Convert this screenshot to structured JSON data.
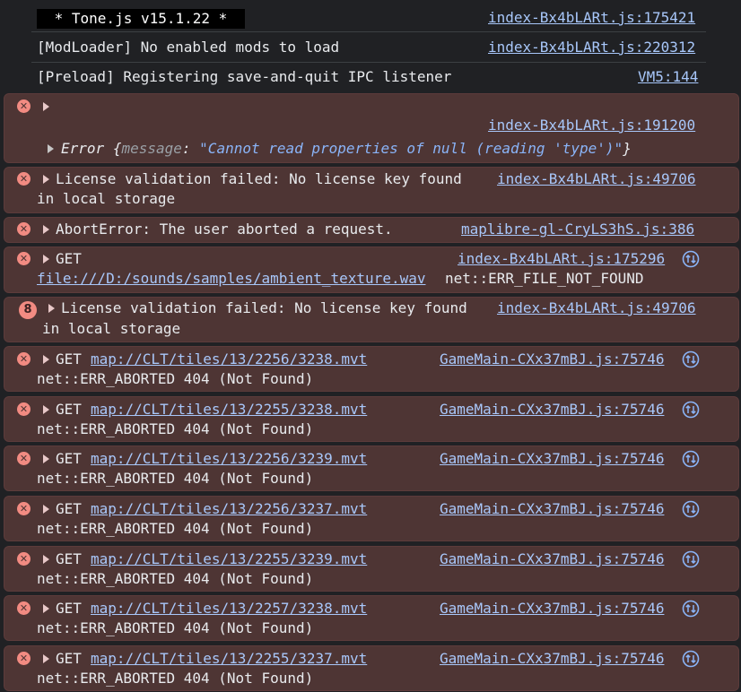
{
  "logs": [
    {
      "text": " * Tone.js v15.1.22 * ",
      "source": "index-Bx4bLARt.js:175421"
    },
    {
      "text": "[ModLoader] No enabled mods to load",
      "source": "index-Bx4bLARt.js:220312"
    },
    {
      "text": "[Preload] Registering save-and-quit IPC listener",
      "source": "VM5:144"
    }
  ],
  "error_null": {
    "source": "index-Bx4bLARt.js:191200",
    "error_label": "Error",
    "open_brace": "{",
    "message_key": "message",
    "colon": ":",
    "message_value": "\"Cannot read properties of null (reading 'type')\"",
    "close_brace": "}"
  },
  "license_error_1": {
    "line1": "License validation failed: No license key found",
    "line2": "in local storage",
    "source": "index-Bx4bLARt.js:49706"
  },
  "abort_error": {
    "text": "AbortError: The user aborted a request.",
    "source": "maplibre-gl-CryLS3hS.js:386"
  },
  "file_error": {
    "method": "GET",
    "url": "file:///D:/sounds/samples/ambient_texture.wav",
    "status": "net::ERR_FILE_NOT_FOUND",
    "source": "index-Bx4bLARt.js:175296"
  },
  "license_error_2": {
    "count": "8",
    "line1": "License validation failed: No license key found",
    "line2": "in local storage",
    "source": "index-Bx4bLARt.js:49706"
  },
  "tile_errors": [
    {
      "method": "GET",
      "url": "map://CLT/tiles/13/2256/3238.mvt",
      "status": "net::ERR_ABORTED 404 (Not Found)",
      "source": "GameMain-CXx37mBJ.js:75746"
    },
    {
      "method": "GET",
      "url": "map://CLT/tiles/13/2255/3238.mvt",
      "status": "net::ERR_ABORTED 404 (Not Found)",
      "source": "GameMain-CXx37mBJ.js:75746"
    },
    {
      "method": "GET",
      "url": "map://CLT/tiles/13/2256/3239.mvt",
      "status": "net::ERR_ABORTED 404 (Not Found)",
      "source": "GameMain-CXx37mBJ.js:75746"
    },
    {
      "method": "GET",
      "url": "map://CLT/tiles/13/2256/3237.mvt",
      "status": "net::ERR_ABORTED 404 (Not Found)",
      "source": "GameMain-CXx37mBJ.js:75746"
    },
    {
      "method": "GET",
      "url": "map://CLT/tiles/13/2255/3239.mvt",
      "status": "net::ERR_ABORTED 404 (Not Found)",
      "source": "GameMain-CXx37mBJ.js:75746"
    },
    {
      "method": "GET",
      "url": "map://CLT/tiles/13/2257/3238.mvt",
      "status": "net::ERR_ABORTED 404 (Not Found)",
      "source": "GameMain-CXx37mBJ.js:75746"
    },
    {
      "method": "GET",
      "url": "map://CLT/tiles/13/2255/3237.mvt",
      "status": "net::ERR_ABORTED 404 (Not Found)",
      "source": "GameMain-CXx37mBJ.js:75746"
    }
  ],
  "icons": {
    "error": "error-x-icon",
    "expand": "expand-triangle-icon",
    "network": "network-request-icon"
  },
  "colors": {
    "background": "#202124",
    "error_row": "#4e3534",
    "error_icon": "#f28b82",
    "link": "#a8c7fa",
    "string_value": "#8ab4f8"
  }
}
